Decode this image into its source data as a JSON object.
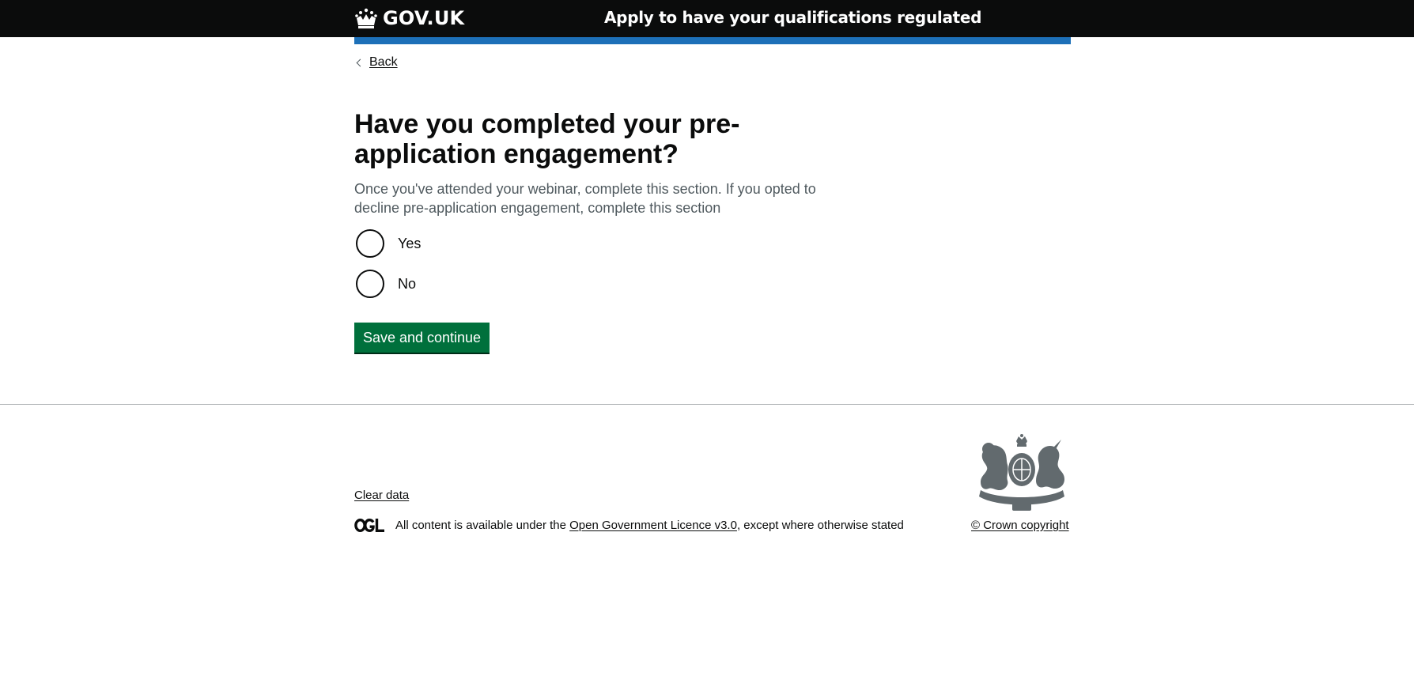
{
  "header": {
    "logo_text": "GOV.UK",
    "service_name": "Apply to have your qualifications regulated"
  },
  "back_link": {
    "label": "Back"
  },
  "question": {
    "heading": "Have you completed your pre-application engagement?",
    "hint": "Once you've attended your webinar, complete this section. If you opted to decline pre-application engagement, complete this section",
    "options": [
      {
        "label": "Yes",
        "selected": false
      },
      {
        "label": "No",
        "selected": false
      }
    ]
  },
  "actions": {
    "save_label": "Save and continue"
  },
  "footer": {
    "clear_data": "Clear data",
    "licence_prefix": "All content is available under the ",
    "licence_link": "Open Government Licence v3.0",
    "licence_suffix": ", except where otherwise stated",
    "copyright": "© Crown copyright"
  },
  "colors": {
    "header_bg": "#0b0c0c",
    "blue_bar": "#1d70b8",
    "button_green": "#00703c",
    "hint_grey": "#505a5f"
  },
  "icons": [
    "crown-icon",
    "back-chevron-icon",
    "ogl-logo-icon",
    "royal-coat-of-arms-icon"
  ]
}
